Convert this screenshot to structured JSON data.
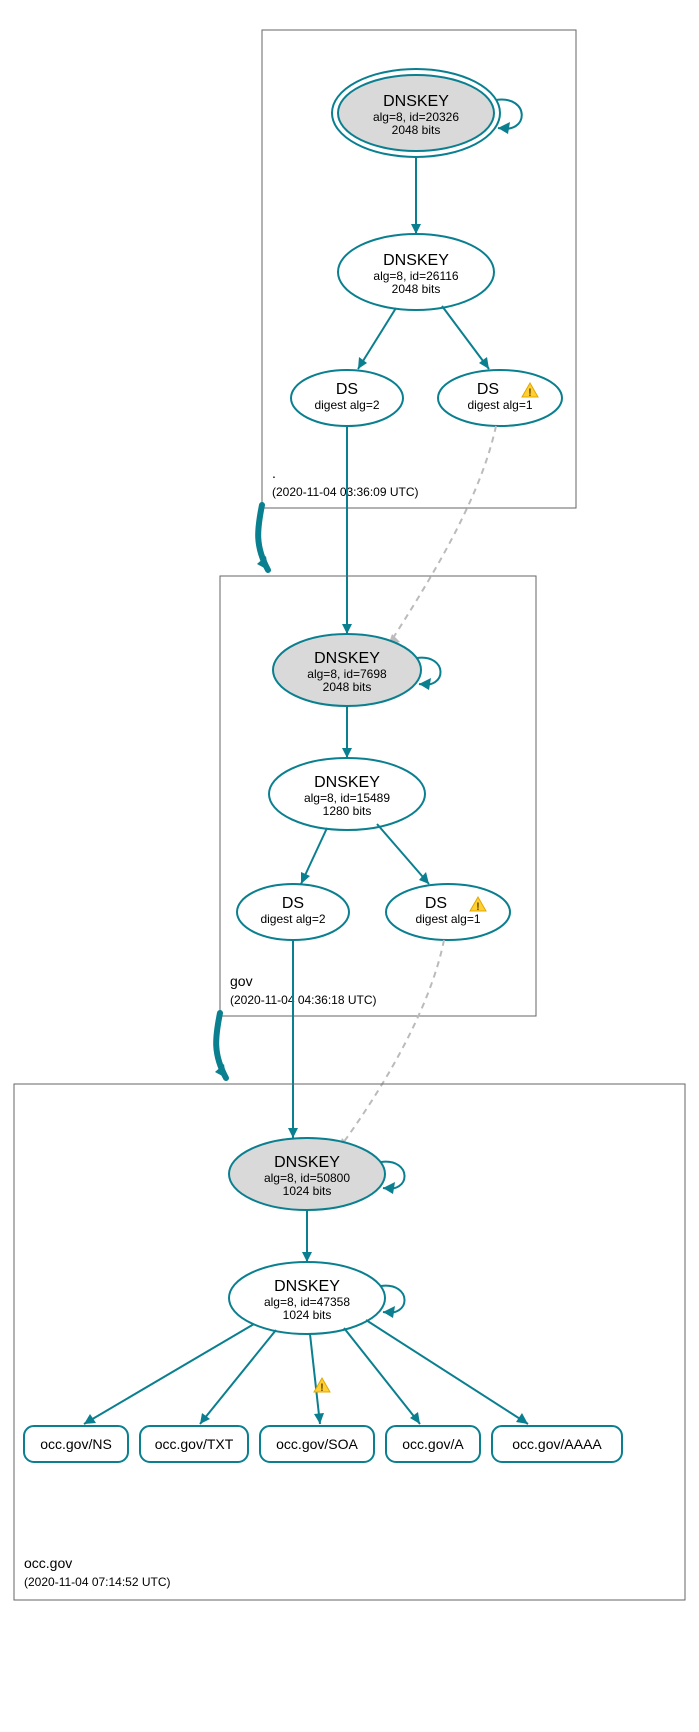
{
  "colors": {
    "accent": "#0a7f8f",
    "shaded": "#d9d9d9",
    "warn": "#ffcf33"
  },
  "zones": {
    "root": {
      "label": ".",
      "timestamp": "(2020-11-04 03:36:09 UTC)"
    },
    "gov": {
      "label": "gov",
      "timestamp": "(2020-11-04 04:36:18 UTC)"
    },
    "occ": {
      "label": "occ.gov",
      "timestamp": "(2020-11-04 07:14:52 UTC)"
    }
  },
  "nodes": {
    "root_ksk": {
      "title": "DNSKEY",
      "line2": "alg=8, id=20326",
      "line3": "2048 bits"
    },
    "root_zsk": {
      "title": "DNSKEY",
      "line2": "alg=8, id=26116",
      "line3": "2048 bits"
    },
    "root_ds1": {
      "title": "DS",
      "line2": "digest alg=2"
    },
    "root_ds2": {
      "title": "DS",
      "line2": "digest alg=1"
    },
    "gov_ksk": {
      "title": "DNSKEY",
      "line2": "alg=8, id=7698",
      "line3": "2048 bits"
    },
    "gov_zsk": {
      "title": "DNSKEY",
      "line2": "alg=8, id=15489",
      "line3": "1280 bits"
    },
    "gov_ds1": {
      "title": "DS",
      "line2": "digest alg=2"
    },
    "gov_ds2": {
      "title": "DS",
      "line2": "digest alg=1"
    },
    "occ_ksk": {
      "title": "DNSKEY",
      "line2": "alg=8, id=50800",
      "line3": "1024 bits"
    },
    "occ_zsk": {
      "title": "DNSKEY",
      "line2": "alg=8, id=47358",
      "line3": "1024 bits"
    }
  },
  "rrsets": {
    "ns": "occ.gov/NS",
    "txt": "occ.gov/TXT",
    "soa": "occ.gov/SOA",
    "a": "occ.gov/A",
    "aaaa": "occ.gov/AAAA"
  }
}
